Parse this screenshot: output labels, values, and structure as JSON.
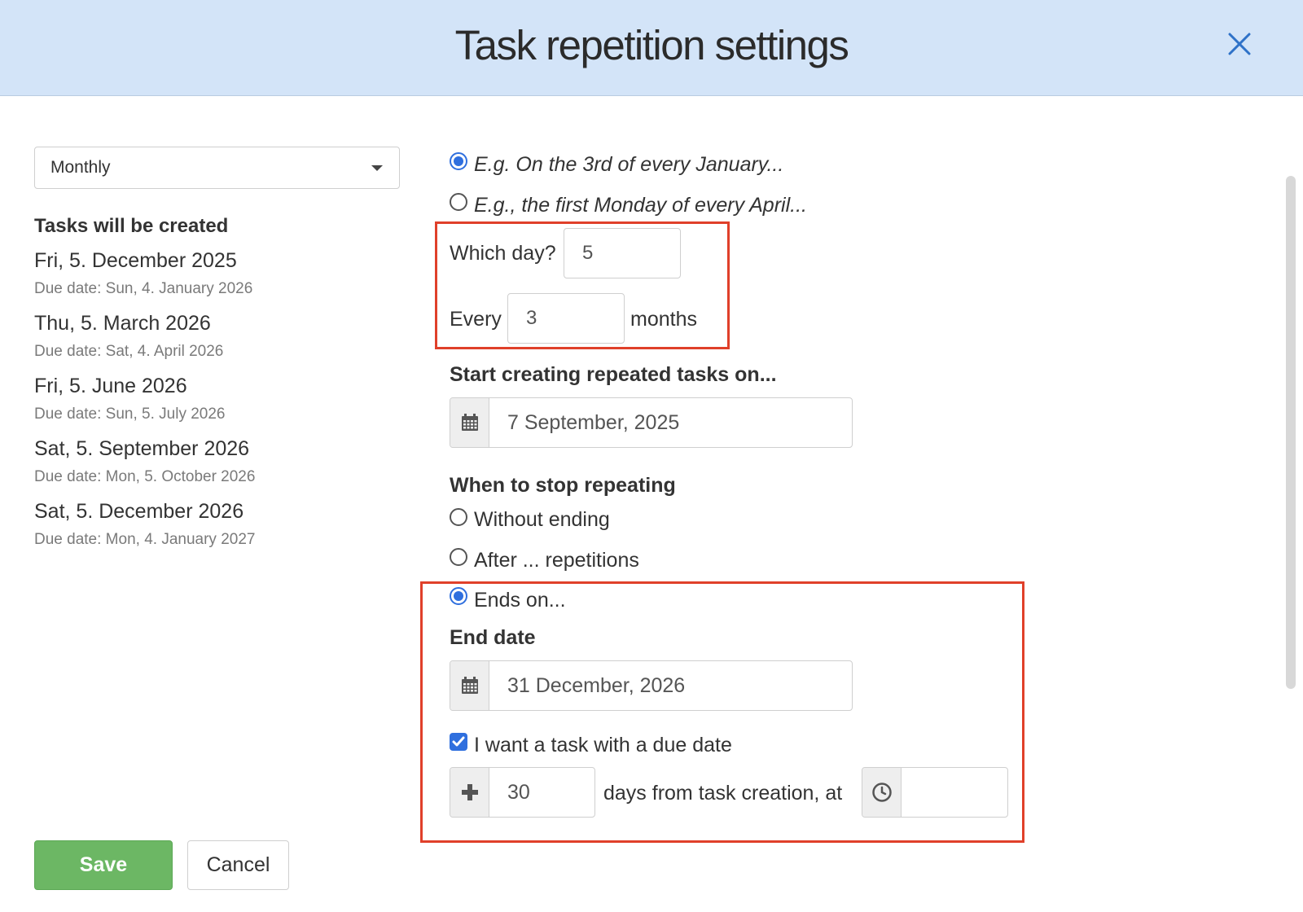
{
  "dialog": {
    "title": "Task repetition settings"
  },
  "frequency": {
    "selected": "Monthly"
  },
  "preview": {
    "title": "Tasks will be created",
    "items": [
      {
        "date": "Fri, 5. December 2025",
        "due": "Due date: Sun, 4. January 2026"
      },
      {
        "date": "Thu, 5. March 2026",
        "due": "Due date: Sat, 4. April 2026"
      },
      {
        "date": "Fri, 5. June 2026",
        "due": "Due date: Sun, 5. July 2026"
      },
      {
        "date": "Sat, 5. September 2026",
        "due": "Due date: Mon, 5. October 2026"
      },
      {
        "date": "Sat, 5. December 2026",
        "due": "Due date: Mon, 4. January 2027"
      }
    ]
  },
  "mode": {
    "options": [
      {
        "label": "E.g. On the 3rd of every January...",
        "checked": true
      },
      {
        "label": "E.g., the first Monday of every April...",
        "checked": false
      }
    ]
  },
  "schedule": {
    "which_day_label": "Which day?",
    "which_day_value": "5",
    "every_label": "Every",
    "every_value": "3",
    "months_label": "months"
  },
  "start": {
    "title": "Start creating repeated tasks on...",
    "date": "7 September, 2025",
    "icon": "calendar-icon"
  },
  "stop": {
    "title": "When to stop repeating",
    "options": [
      {
        "label": "Without ending",
        "checked": false
      },
      {
        "label": "After ... repetitions",
        "checked": false
      },
      {
        "label": "Ends on...",
        "checked": true
      }
    ],
    "end_date_title": "End date",
    "end_date": "31 December, 2026"
  },
  "due": {
    "checkbox_label": "I want a task with a due date",
    "checked": true,
    "days": "30",
    "days_label": "days from task creation, at",
    "time": ""
  },
  "actions": {
    "save": "Save",
    "cancel": "Cancel"
  },
  "colors": {
    "header_bg": "#d3e4f8",
    "accent": "#2f6fde",
    "save": "#6cb764",
    "highlight": "#e0402a"
  }
}
